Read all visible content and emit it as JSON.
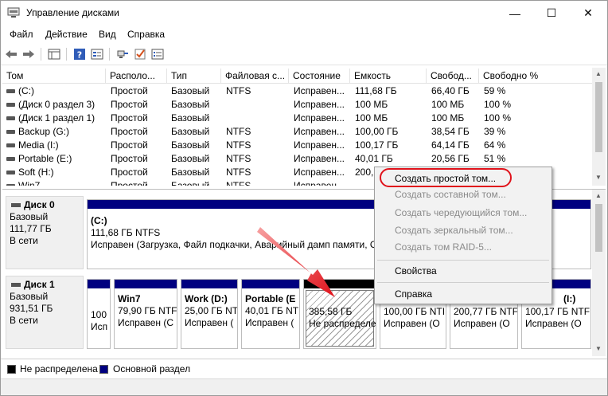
{
  "window": {
    "title": "Управление дисками",
    "minimize_glyph": "—",
    "maximize_glyph": "☐",
    "close_glyph": "✕"
  },
  "menu": [
    "Файл",
    "Действие",
    "Вид",
    "Справка"
  ],
  "toolbar": {
    "icons": [
      "back-arrow-icon",
      "forward-arrow-icon",
      "console-tree-icon",
      "help-icon",
      "properties-icon",
      "connect-icon",
      "check-icon",
      "list-icon"
    ]
  },
  "volume_table": {
    "columns": [
      "Том",
      "Располо...",
      "Тип",
      "Файловая с...",
      "Состояние",
      "Емкость",
      "Свобод...",
      "Свободно %"
    ],
    "rows": [
      [
        "(C:)",
        "Простой",
        "Базовый",
        "NTFS",
        "Исправен...",
        "111,68 ГБ",
        "66,40 ГБ",
        "59 %"
      ],
      [
        "(Диск 0 раздел 3)",
        "Простой",
        "Базовый",
        "",
        "Исправен...",
        "100 МБ",
        "100 МБ",
        "100 %"
      ],
      [
        "(Диск 1 раздел 1)",
        "Простой",
        "Базовый",
        "",
        "Исправен...",
        "100 МБ",
        "100 МБ",
        "100 %"
      ],
      [
        "Backup (G:)",
        "Простой",
        "Базовый",
        "NTFS",
        "Исправен...",
        "100,00 ГБ",
        "38,54 ГБ",
        "39 %"
      ],
      [
        "Media (I:)",
        "Простой",
        "Базовый",
        "NTFS",
        "Исправен...",
        "100,17 ГБ",
        "64,14 ГБ",
        "64 %"
      ],
      [
        "Portable (E:)",
        "Простой",
        "Базовый",
        "NTFS",
        "Исправен...",
        "40,01 ГБ",
        "20,56 ГБ",
        "51 %"
      ],
      [
        "Soft (H:)",
        "Простой",
        "Базовый",
        "NTFS",
        "Исправен...",
        "200,...",
        "",
        ""
      ],
      [
        "Win7",
        "Простой",
        "Базовый",
        "NTFS",
        "Исправен...",
        "",
        "",
        ""
      ]
    ]
  },
  "disks": [
    {
      "name": "Диск 0",
      "type": "Базовый",
      "size": "111,77 ГБ",
      "status": "В сети",
      "partitions": [
        {
          "title": "(C:)",
          "line2": "111,68 ГБ NTFS",
          "line3": "Исправен (Загрузка, Файл подкачки, Аварийный дамп памяти, Ос"
        }
      ]
    },
    {
      "name": "Диск 1",
      "type": "Базовый",
      "size": "931,51 ГБ",
      "status": "В сети",
      "partitions": [
        {
          "title": "",
          "line2": "100",
          "line3": "Исп"
        },
        {
          "title": "Win7",
          "line2": "79,90 ГБ NTF",
          "line3": "Исправен (С"
        },
        {
          "title": "Work  (D:)",
          "line2": "25,00 ГБ NTF",
          "line3": "Исправен ("
        },
        {
          "title": "Portable  (E",
          "line2": "40,01 ГБ NTF",
          "line3": "Исправен ("
        },
        {
          "title": "",
          "line2": "385,58 ГБ",
          "line3": "Не распределе"
        },
        {
          "title": "",
          "line2": "100,00 ГБ NTI",
          "line3": "Исправен (О"
        },
        {
          "title": "",
          "line2": "200,77 ГБ NTF",
          "line3": "Исправен (О"
        },
        {
          "title": "(I:)",
          "line2": "100,17 ГБ NTF",
          "line3": "Исправен (О"
        }
      ]
    }
  ],
  "legend": [
    {
      "label": "Не распределена",
      "color": "#000000"
    },
    {
      "label": "Основной раздел",
      "color": "#000080"
    }
  ],
  "context_menu": {
    "items": [
      {
        "label": "Создать простой том...",
        "enabled": true
      },
      {
        "label": "Создать составной том...",
        "enabled": false
      },
      {
        "label": "Создать чередующийся том...",
        "enabled": false
      },
      {
        "label": "Создать зеркальный том...",
        "enabled": false
      },
      {
        "label": "Создать том RAID-5...",
        "enabled": false
      },
      {
        "label": "Свойства",
        "enabled": true
      },
      {
        "label": "Справка",
        "enabled": true
      }
    ]
  },
  "colors": {
    "primary_partition": "#000080",
    "unallocated": "#000000",
    "annotation_red": "#e0121b"
  }
}
